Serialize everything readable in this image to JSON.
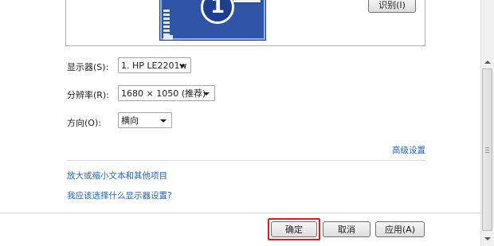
{
  "preview": {
    "monitor_number": "1",
    "identify_label": "识别(I)"
  },
  "settings": {
    "display_label": "显示器(S):",
    "display_value": "1. HP LE2201w",
    "resolution_label": "分辨率(R):",
    "resolution_value": "1680 × 1050 (推荐)",
    "orientation_label": "方向(O):",
    "orientation_value": "横向",
    "advanced_link": "高级设置"
  },
  "links": {
    "text_size": "放大或缩小文本和其他项目",
    "which_settings": "我应该选择什么显示器设置?"
  },
  "buttons": {
    "ok": "确定",
    "cancel": "取消",
    "apply": "应用(A)"
  },
  "colors": {
    "highlight": "#e01b1b",
    "link": "#1c63c8",
    "monitor": "#2f55a8"
  }
}
